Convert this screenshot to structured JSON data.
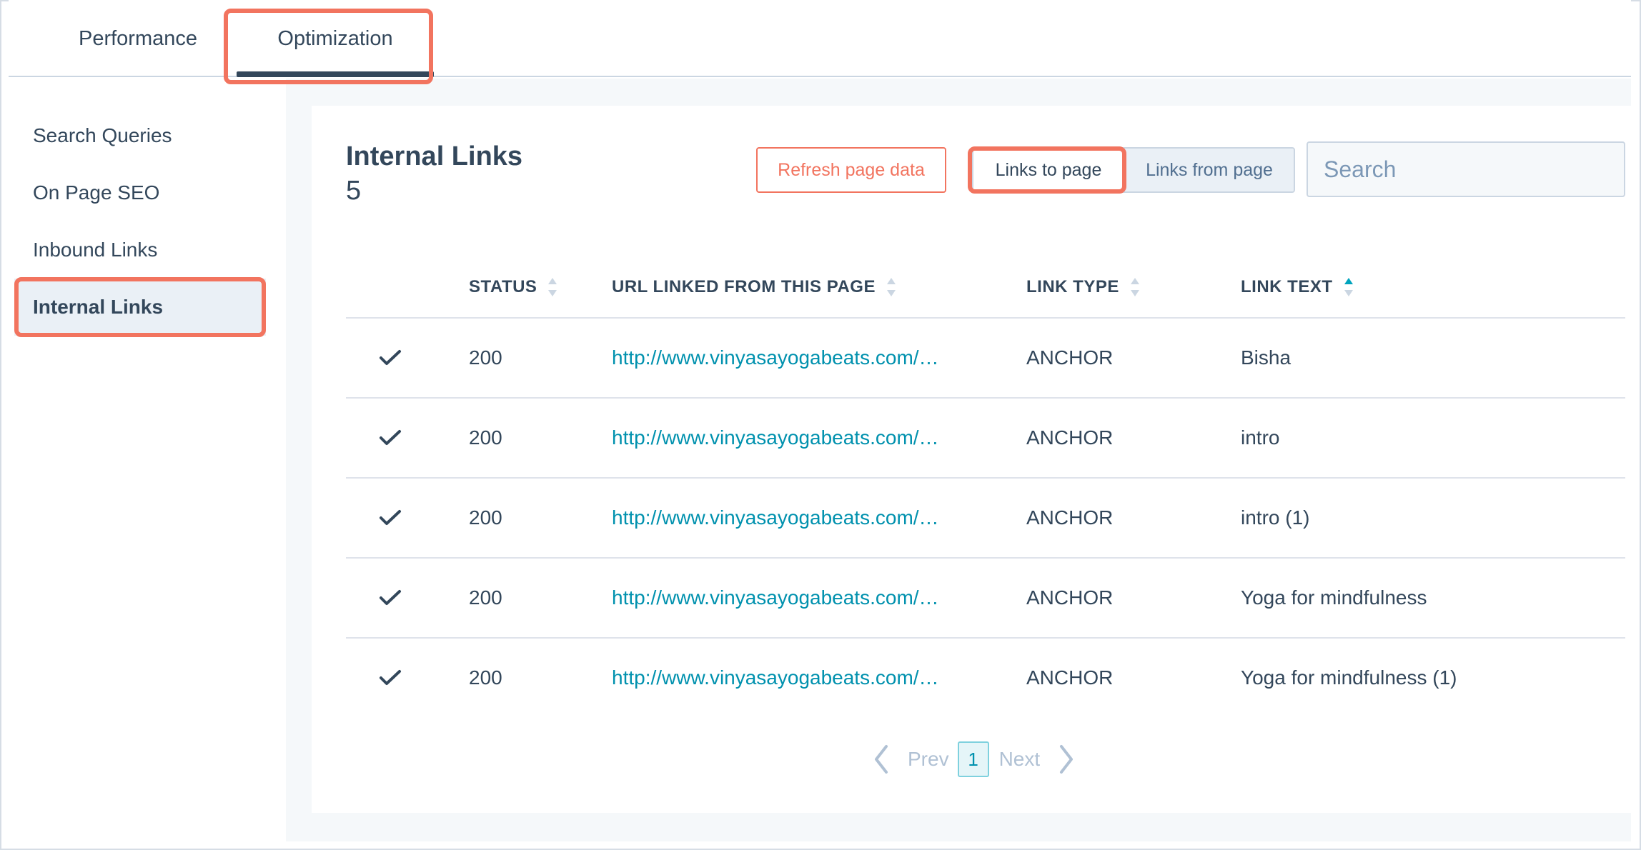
{
  "tabs": [
    {
      "label": "Performance"
    },
    {
      "label": "Optimization"
    }
  ],
  "sidebar": {
    "items": [
      {
        "label": "Search Queries"
      },
      {
        "label": "On Page SEO"
      },
      {
        "label": "Inbound Links"
      },
      {
        "label": "Internal Links"
      }
    ]
  },
  "panel": {
    "title": "Internal Links",
    "count": "5",
    "refresh_label": "Refresh page data",
    "links_to_label": "Links to page",
    "links_from_label": "Links from page",
    "search_placeholder": "Search"
  },
  "table": {
    "headers": {
      "status": "STATUS",
      "url": "URL LINKED FROM THIS PAGE",
      "type": "LINK TYPE",
      "text": "LINK TEXT"
    },
    "rows": [
      {
        "status": "200",
        "url": "http://www.vinyasayogabeats.com/…",
        "type": "ANCHOR",
        "text": "Bisha"
      },
      {
        "status": "200",
        "url": "http://www.vinyasayogabeats.com/…",
        "type": "ANCHOR",
        "text": "intro"
      },
      {
        "status": "200",
        "url": "http://www.vinyasayogabeats.com/…",
        "type": "ANCHOR",
        "text": "intro (1)"
      },
      {
        "status": "200",
        "url": "http://www.vinyasayogabeats.com/…",
        "type": "ANCHOR",
        "text": "Yoga for mindfulness"
      },
      {
        "status": "200",
        "url": "http://www.vinyasayogabeats.com/…",
        "type": "ANCHOR",
        "text": "Yoga for mindfulness (1)"
      }
    ]
  },
  "pagination": {
    "prev_label": "Prev",
    "current_page": "1",
    "next_label": "Next"
  },
  "colors": {
    "accent": "#f2745f",
    "link": "#0091ae",
    "text": "#33475b"
  },
  "icons": {
    "check": "checkmark-icon",
    "search": "search-icon",
    "sort": "sort-icon",
    "sort_asc": "sort-ascending-icon",
    "prev": "chevron-left-icon",
    "next": "chevron-right-icon"
  }
}
